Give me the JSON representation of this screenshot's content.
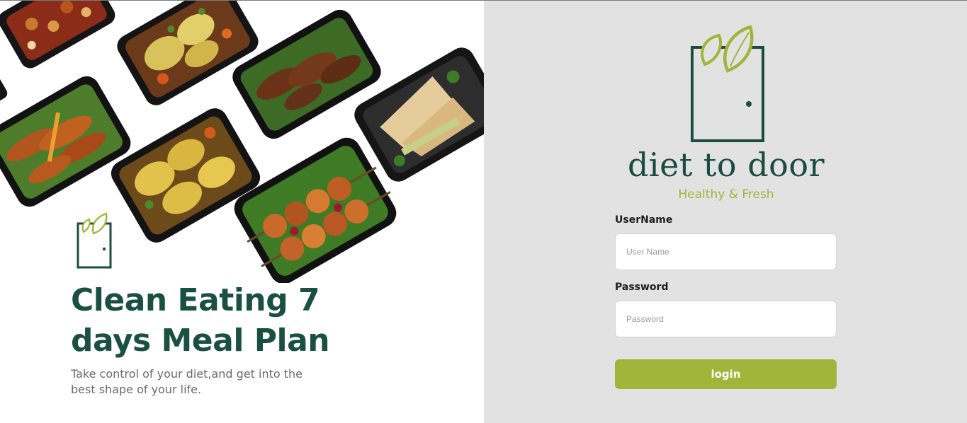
{
  "hero": {
    "title_line1": "Clean Eating 7",
    "title_line2": "days Meal Plan",
    "subtitle_line1": "Take control of your diet,and get into the",
    "subtitle_line2": "best shape of your life."
  },
  "brand": {
    "name": "diet to door",
    "tagline": "Healthy & Fresh",
    "logo_icon": "door-with-leaves-icon",
    "primary_color": "#1b4d3e",
    "accent_color": "#a1b53a"
  },
  "login_form": {
    "username_label": "UserName",
    "username_placeholder": "User Name",
    "username_value": "",
    "password_label": "Password",
    "password_placeholder": "Password",
    "password_value": "",
    "submit_label": "login"
  },
  "colors": {
    "left_background": "#ffffff",
    "right_background": "#e2e2e2",
    "heading_green": "#19503f",
    "button_green": "#a1b53a"
  }
}
